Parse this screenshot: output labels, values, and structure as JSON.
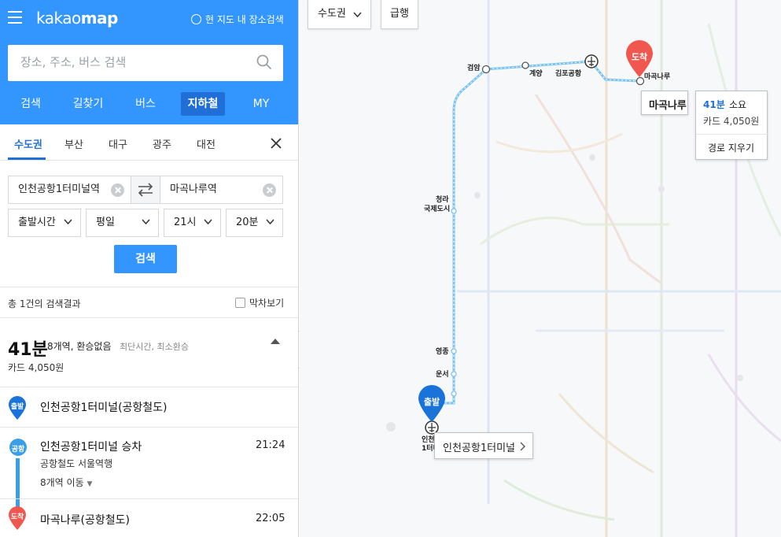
{
  "header": {
    "logo_main": "kakao",
    "logo_sub": "map",
    "nearby_search": "현 지도 내 장소검색",
    "search_placeholder": "장소, 주소, 버스 검색"
  },
  "nav_tabs": [
    {
      "label": "검색"
    },
    {
      "label": "길찾기"
    },
    {
      "label": "버스"
    },
    {
      "label": "지하철",
      "active": true
    },
    {
      "label": "MY"
    }
  ],
  "regions": [
    {
      "label": "수도권",
      "active": true
    },
    {
      "label": "부산"
    },
    {
      "label": "대구"
    },
    {
      "label": "광주"
    },
    {
      "label": "대전"
    }
  ],
  "route_form": {
    "origin": "인천공항1터미널역",
    "destination": "마곡나루역",
    "time_type": "출발시간",
    "day_type": "평일",
    "hour": "21시",
    "minute": "20분",
    "search_button": "검색"
  },
  "results": {
    "count_text": "총 1건의 검색결과",
    "last_train_label": "막차보기",
    "duration": "41분",
    "summary": "8개역, 환승없음",
    "tags": "최단시간, 최소환승",
    "fare": "카드 4,050원"
  },
  "steps": {
    "start": {
      "badge": "출발",
      "station": "인천공항1터미널(공항철도)"
    },
    "board": {
      "badge": "공항",
      "station": "인천공항1터미널 승차",
      "time": "21:24",
      "direction": "공항철도 서울역행",
      "stops": "8개역 이동"
    },
    "end": {
      "badge": "도착",
      "station": "마곡나루(공항철도)",
      "time": "22:05"
    }
  },
  "map": {
    "region_button": "수도권",
    "express_button": "급행",
    "dest_marker": "도착",
    "start_marker": "출발",
    "dest_card": {
      "station": "마곡나루",
      "minutes": "41분",
      "suffix": "소요",
      "fare": "카드 4,050원",
      "clear_route": "경로 지우기"
    },
    "start_card": {
      "station": "인천공항1터미널"
    },
    "stations": {
      "geomam": "검암",
      "gyeyang": "계양",
      "gimpo": "김포공항",
      "magoknaru": "마곡나루",
      "cheongna1": "청라",
      "cheongna2": "국제도시",
      "yeongjong": "영종",
      "unseo": "운서",
      "airport1": "인천",
      "airport2": "1터미"
    }
  },
  "colors": {
    "brand_blue": "#3396FF",
    "tab_active": "#1F6FD6",
    "airport_line": "#3A9FE6",
    "start_pin": "#1A73D9",
    "end_pin": "#F0584F"
  }
}
